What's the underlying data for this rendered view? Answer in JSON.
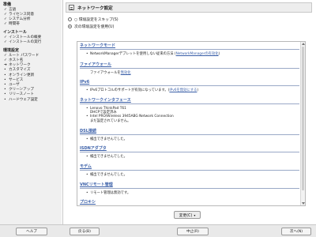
{
  "sidebar": {
    "sections": [
      {
        "title": "準備",
        "items": [
          {
            "label": "言語",
            "mark": "✓"
          },
          {
            "label": "ライセンス同意",
            "mark": "✓"
          },
          {
            "label": "システム分析",
            "mark": "✓"
          },
          {
            "label": "時間帯",
            "mark": "✓"
          }
        ]
      },
      {
        "title": "インストール",
        "items": [
          {
            "label": "インストールの概要",
            "mark": "✓"
          },
          {
            "label": "インストールの実行",
            "mark": "✓"
          }
        ]
      },
      {
        "title": "環境設定",
        "items": [
          {
            "label": "ルート パスワード",
            "mark": "✓"
          },
          {
            "label": "ホスト名",
            "mark": "✓"
          },
          {
            "label": "ネットワーク",
            "mark": "➔"
          },
          {
            "label": "カスタマイズ",
            "mark": "•"
          },
          {
            "label": "オンライン更新",
            "mark": "•"
          },
          {
            "label": "サービス",
            "mark": "•"
          },
          {
            "label": "ユーザ",
            "mark": "•"
          },
          {
            "label": "クリーンアップ",
            "mark": "•"
          },
          {
            "label": "リリースノート",
            "mark": "•"
          },
          {
            "label": "ハードウェア設定",
            "mark": "•"
          }
        ]
      }
    ]
  },
  "header": {
    "title": "ネットワーク設定",
    "icon": "network-card-icon"
  },
  "options": [
    {
      "label": "○ 環境設定をスキップ(S)",
      "selected": false
    },
    {
      "label": "次の環境設定を使用(U)",
      "selected": true
    }
  ],
  "sections": [
    {
      "title": "ネットワークモード",
      "lines": [
        {
          "type": "bullet",
          "text": "NetworkManagerデプレットを使用しない従来の方法 (",
          "link": "NetworkManagerの有効化",
          "after": ")"
        }
      ]
    },
    {
      "title": "ファイアウォール",
      "lines": [
        {
          "type": "plain",
          "text": "ファイアウォールを",
          "link": "無効化",
          "after": ""
        }
      ]
    },
    {
      "title": "IPv6",
      "lines": [
        {
          "type": "bullet",
          "text": "IPv6プロトコルのサポートが有効になっています。(",
          "link": "IPv6を無効にする",
          "after": ")"
        }
      ]
    },
    {
      "title": "ネットワークインタフェース",
      "lines": [
        {
          "type": "bullet",
          "text": "Lenovo ThinkPad T61"
        },
        {
          "type": "plain",
          "text": "DHCPで設定済み"
        },
        {
          "type": "bullet",
          "text": "Intel PRO/Wireless 3945ABG Network Connection"
        },
        {
          "type": "plain",
          "text": "まだ設定されていません。"
        }
      ]
    },
    {
      "title": "DSL接続",
      "lines": [
        {
          "type": "bullet",
          "text": "検出できませんでした。"
        }
      ]
    },
    {
      "title": "ISDNアダプタ",
      "lines": [
        {
          "type": "bullet",
          "text": "検出できませんでした。"
        }
      ]
    },
    {
      "title": "モデム",
      "lines": [
        {
          "type": "bullet",
          "text": "検出できませんでした。"
        }
      ]
    },
    {
      "title": "VNCリモート管理",
      "lines": [
        {
          "type": "bullet",
          "text": "リモート管理は無効です。"
        }
      ]
    },
    {
      "title": "プロキシ",
      "lines": []
    }
  ],
  "change_button": {
    "label": "変更(C)",
    "caret": "▾"
  },
  "bottom": {
    "help": "ヘルプ",
    "back": "戻る(B)",
    "abort": "中止(R)",
    "next": "次へ(N)"
  }
}
